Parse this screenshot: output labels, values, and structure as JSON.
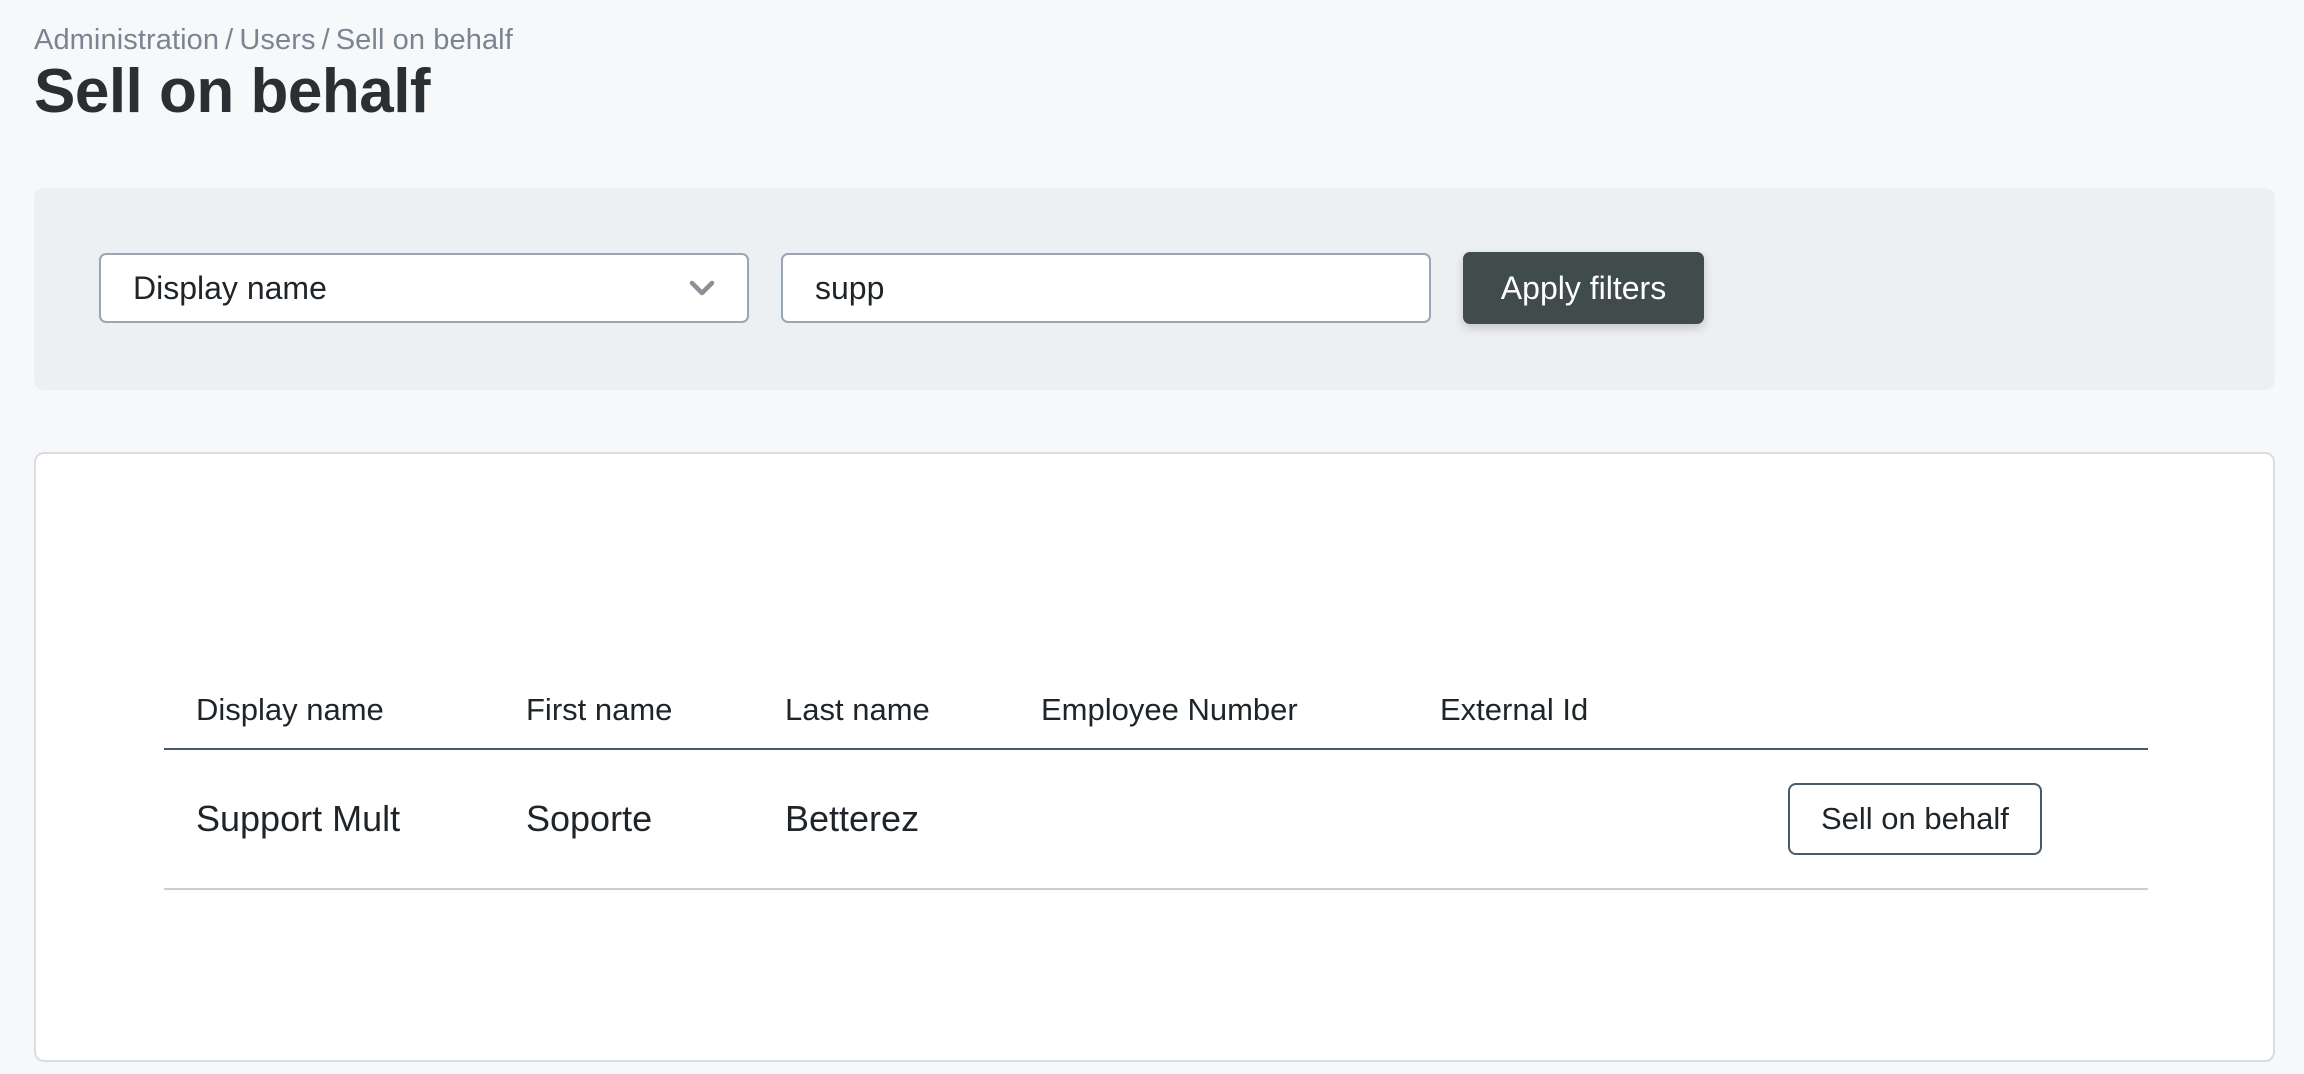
{
  "breadcrumb": {
    "items": [
      "Administration",
      "Users",
      "Sell on behalf"
    ],
    "separator": "/"
  },
  "page_title": "Sell on behalf",
  "filters": {
    "field_select": {
      "selected": "Display name"
    },
    "search_input": {
      "value": "supp",
      "placeholder": ""
    },
    "apply_label": "Apply filters"
  },
  "table": {
    "columns": [
      "Display name",
      "First name",
      "Last name",
      "Employee Number",
      "External Id",
      ""
    ],
    "rows": [
      {
        "display_name": "Support Mult",
        "first_name": "Soporte",
        "last_name": "Betterez",
        "employee_number": "",
        "external_id": "",
        "action_label": "Sell on behalf"
      }
    ]
  },
  "icons": {
    "select_chevron": "chevron-down-icon"
  },
  "colors": {
    "background": "#f7f8fa",
    "filter_panel": "#edf0f2",
    "primary_button": "#3f4c4b",
    "breadcrumb_text": "#7a8591",
    "header_rule": "#4b5a6a"
  }
}
